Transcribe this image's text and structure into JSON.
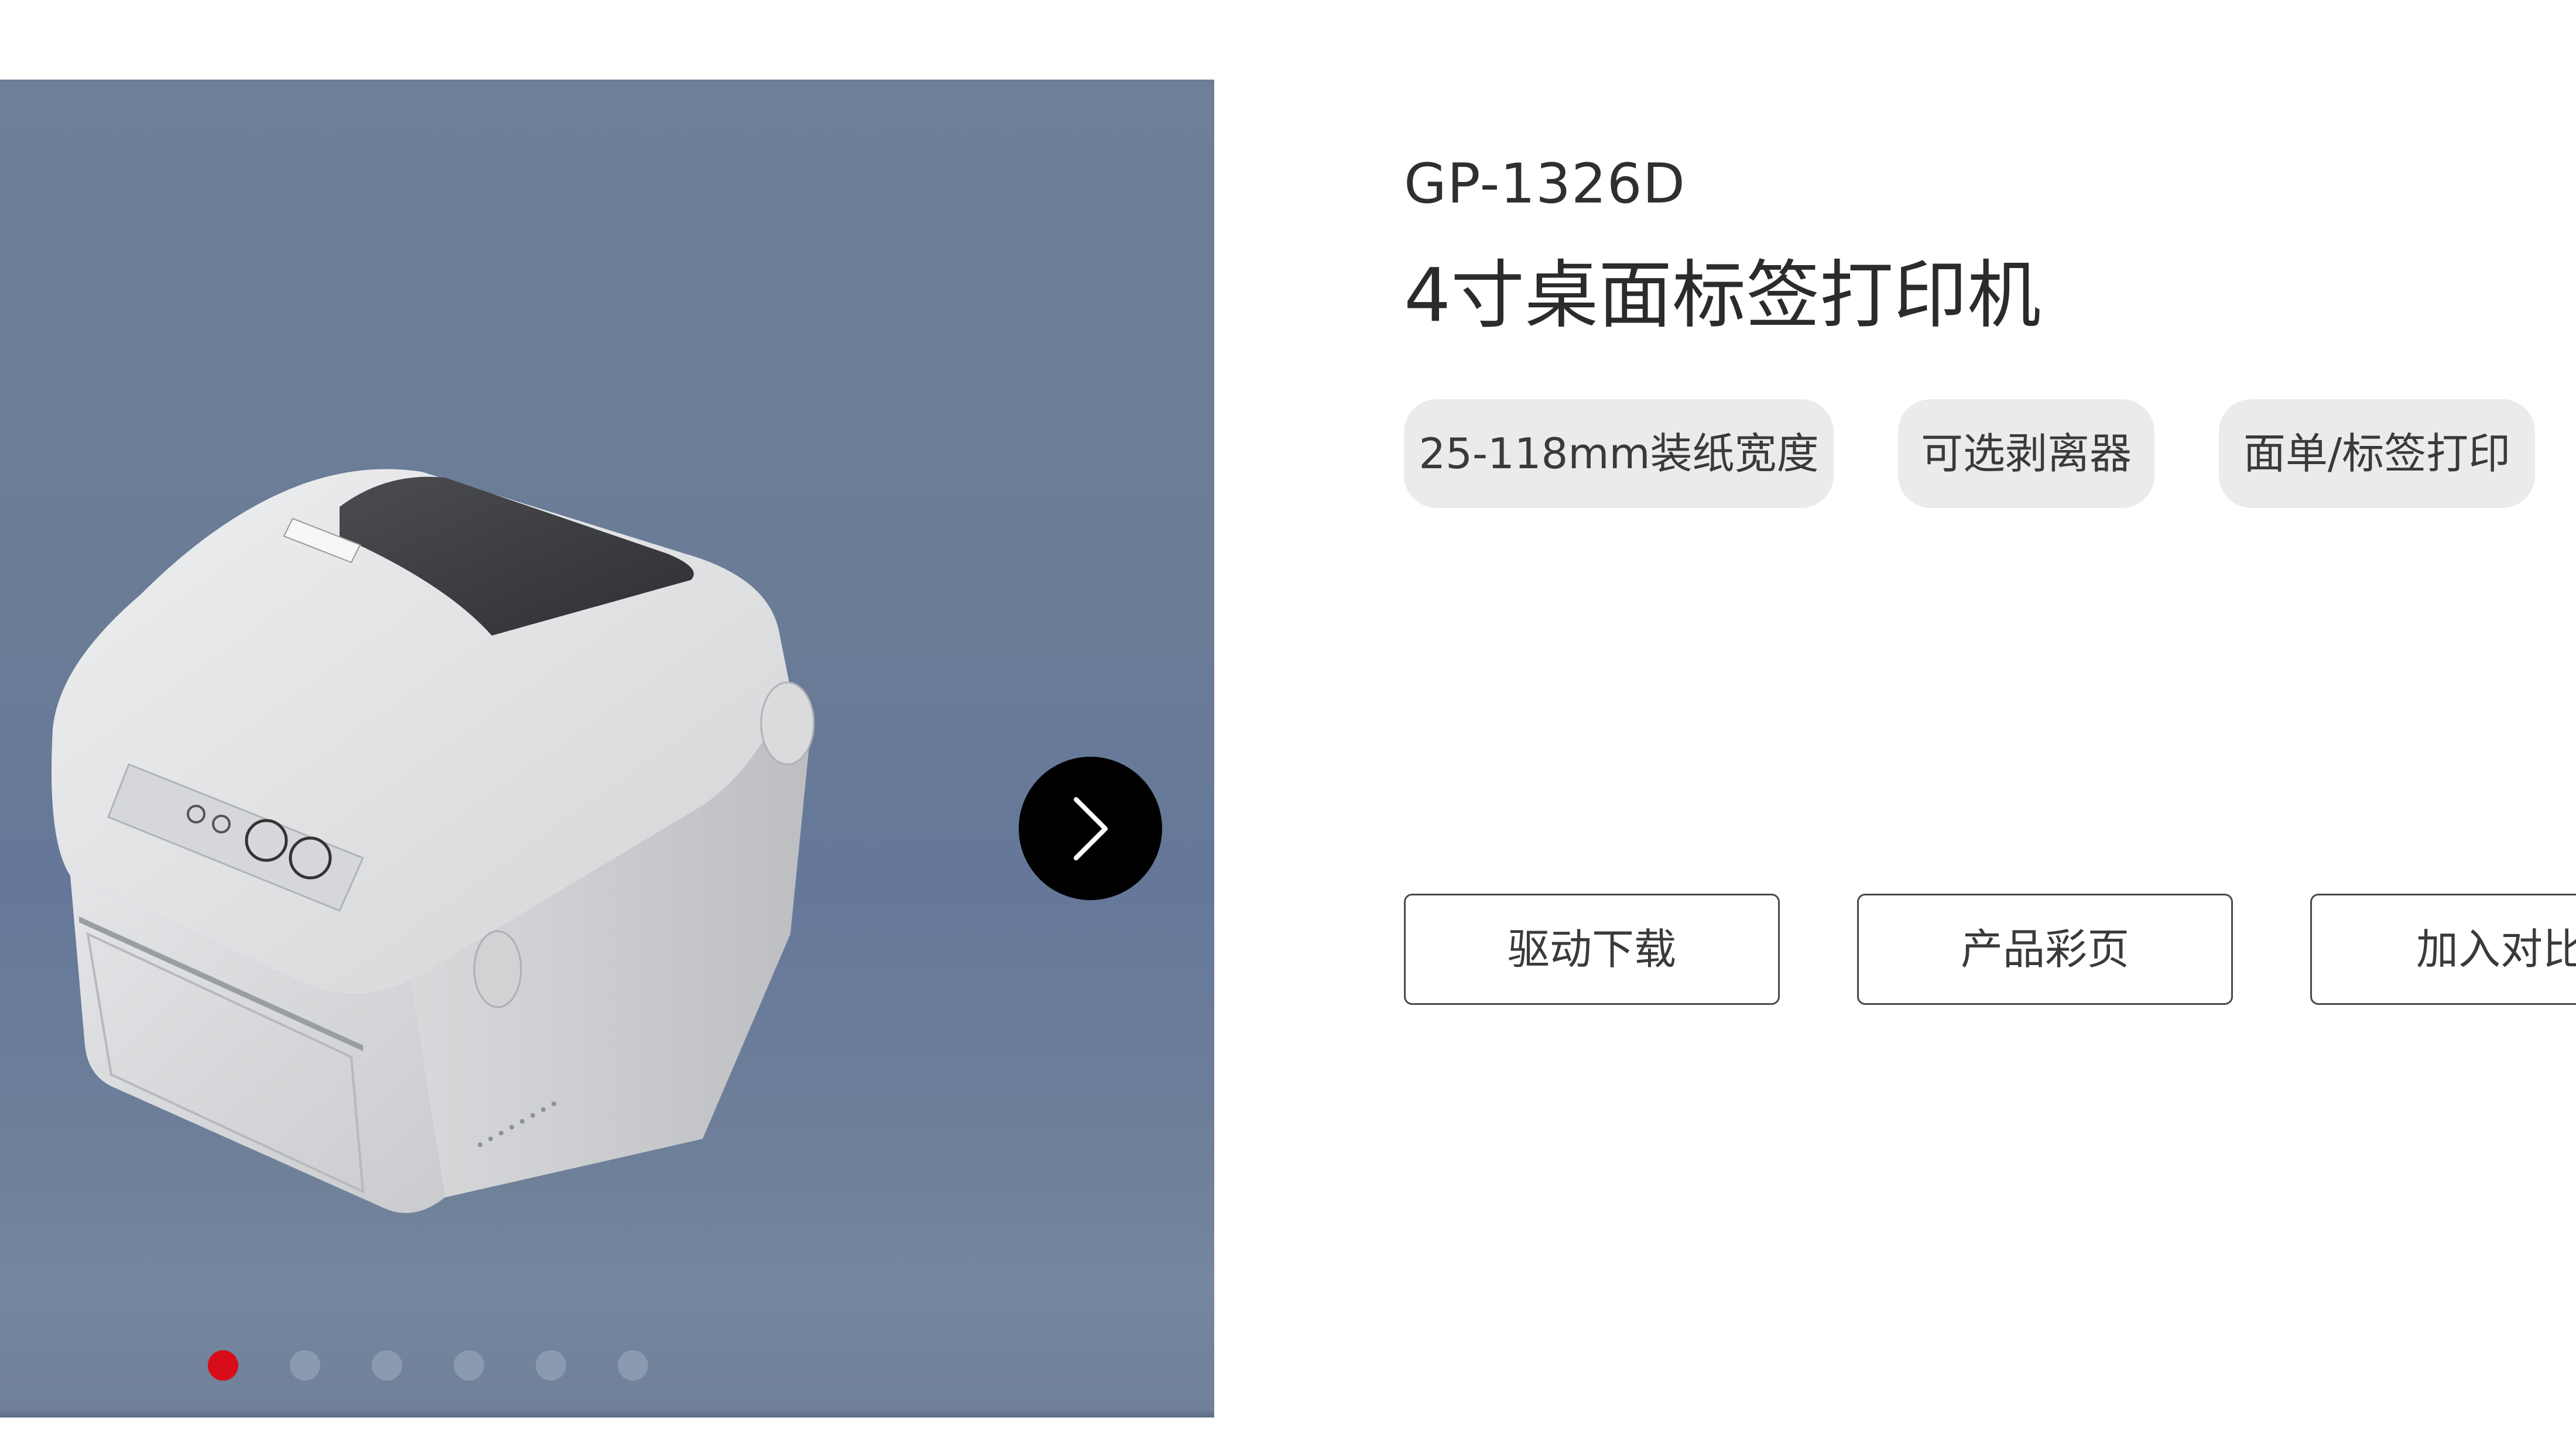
{
  "carousel": {
    "next_icon": "chevron-right-icon",
    "slide_count": 6,
    "active_slide": 1,
    "active_dot_color": "#d70c18",
    "inactive_dot_color": "#8a9ab0",
    "background_color": "#6b7d97"
  },
  "product": {
    "model": "GP-1326D",
    "title": "4寸桌面标签打印机",
    "image": "thermal-label-printer-image",
    "tags": [
      "25-118mm装纸宽度",
      "可选剥离器",
      "面单/标签打印"
    ]
  },
  "actions": {
    "driver_download": "驱动下载",
    "brochure": "产品彩页",
    "add_compare": "加入对比"
  }
}
